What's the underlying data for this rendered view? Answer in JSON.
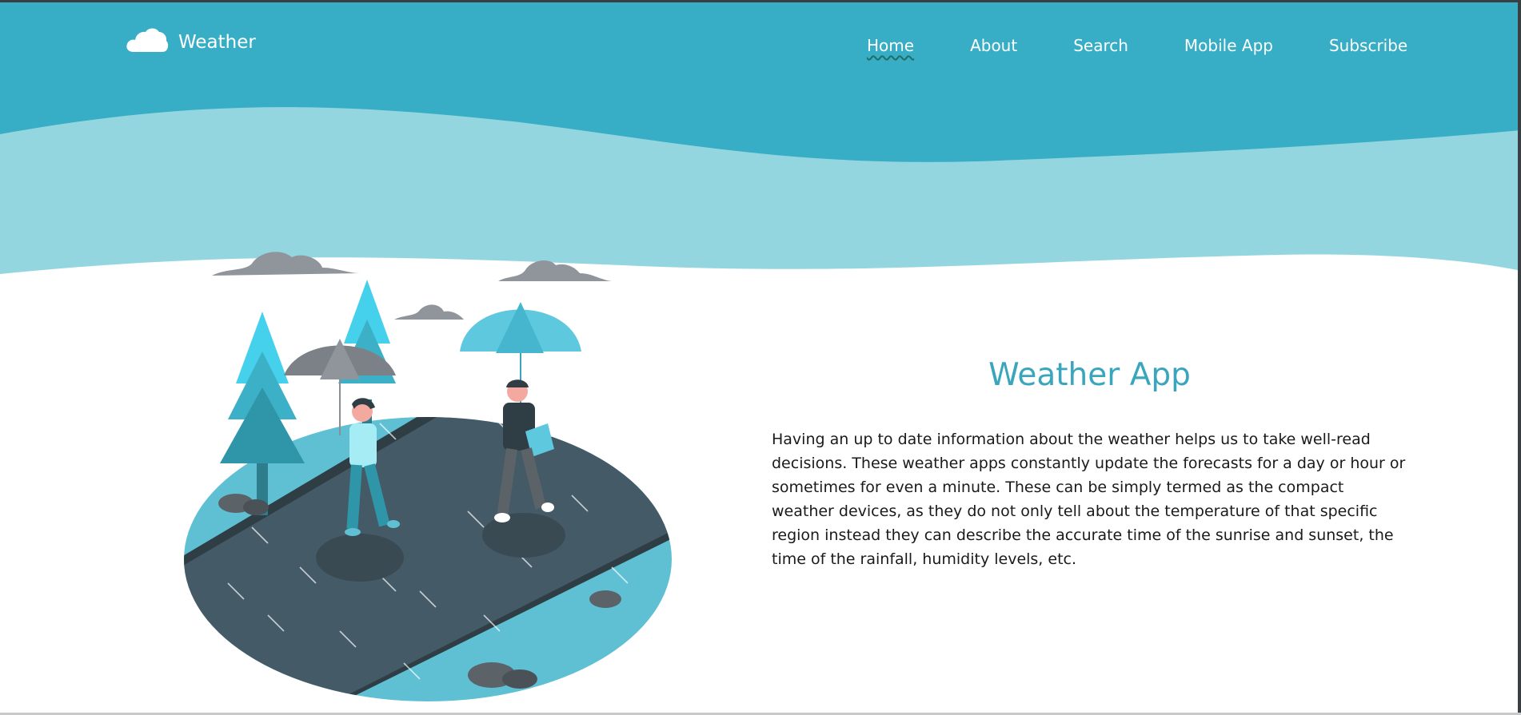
{
  "colors": {
    "header": "#37aec6",
    "wave": "#94d6e0",
    "accent": "#3aa6bd",
    "road": "#445a66",
    "ground": "#5fc0d3"
  },
  "brand": {
    "icon": "cloud-icon",
    "name": "Weather"
  },
  "nav": {
    "items": [
      {
        "label": "Home",
        "active": true
      },
      {
        "label": "About",
        "active": false
      },
      {
        "label": "Search",
        "active": false
      },
      {
        "label": "Mobile App",
        "active": false
      },
      {
        "label": "Subscribe",
        "active": false
      }
    ]
  },
  "main": {
    "title": "Weather App",
    "description": "Having an up to date information about the weather helps us to take well-read decisions. These weather apps constantly update the forecasts for a day or hour or sometimes for even a minute. These can be simply termed as the compact weather devices, as they do not only tell about the temperature of that specific region instead they can describe the accurate time of the sunrise and sunset, the time of the rainfall, humidity levels, etc."
  }
}
